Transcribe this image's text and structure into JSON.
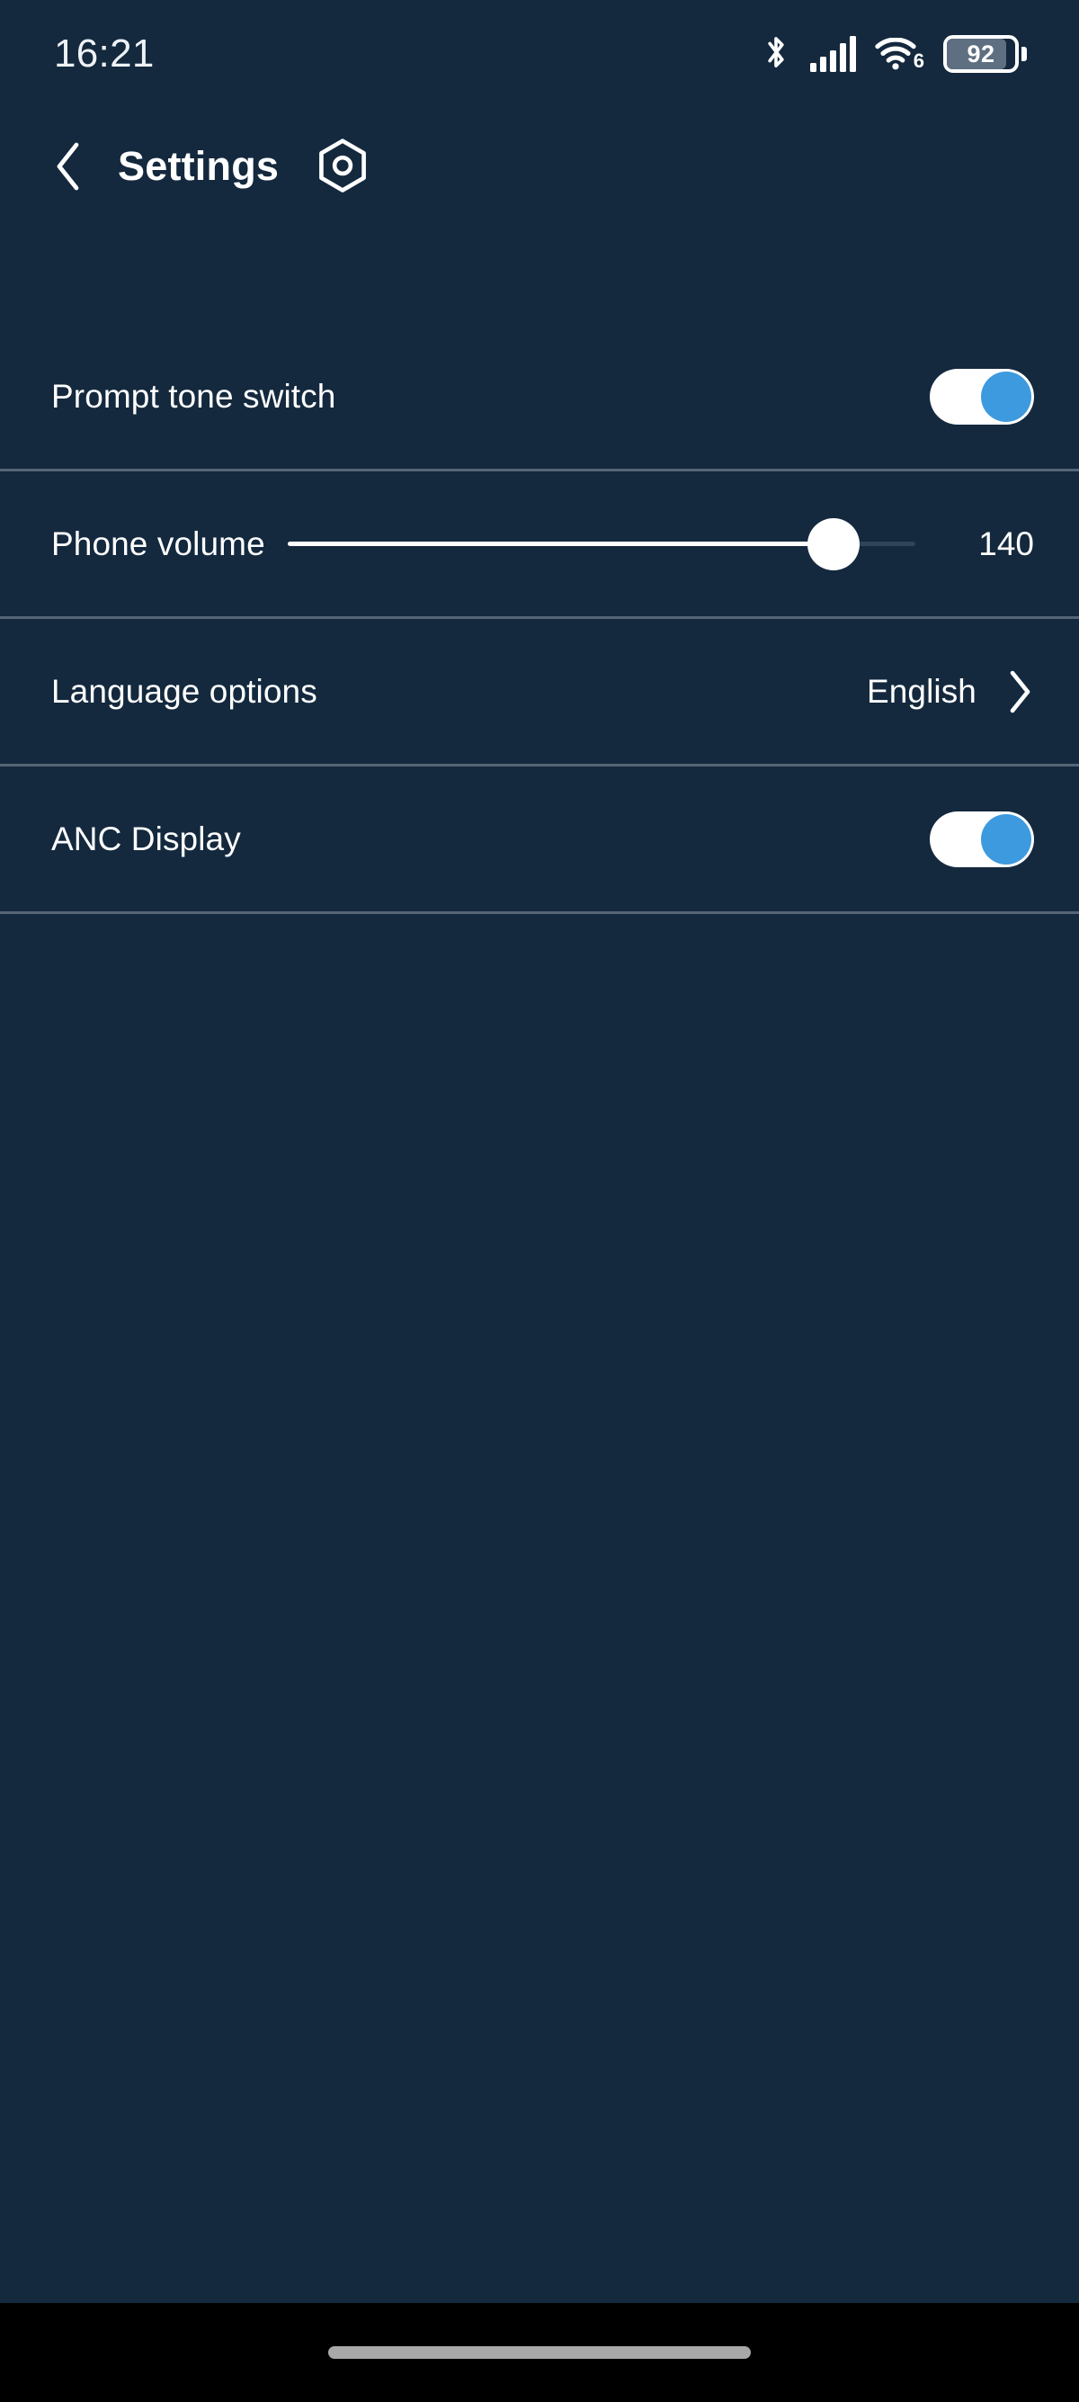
{
  "theme": {
    "background": "#14293e",
    "divider": "#566575",
    "accent_blue": "#3d9ade",
    "text_primary": "#ffffff",
    "navbar_background": "#000000",
    "slider_track_inactive": "#2f4457"
  },
  "status_bar": {
    "time": "16:21",
    "bluetooth_icon": "bluetooth-icon",
    "signal_icon": "cellular-signal-icon",
    "signal_bars_filled": 5,
    "signal_bars_total": 5,
    "wifi_icon": "wifi-icon",
    "wifi_generation": "6",
    "battery_icon": "battery-icon",
    "battery_level": "92"
  },
  "header": {
    "back_icon": "chevron-left-icon",
    "title": "Settings",
    "device_icon": "hex-nut-icon"
  },
  "settings": {
    "rows": [
      {
        "id": "prompt-tone-switch",
        "label": "Prompt tone switch",
        "control": "toggle",
        "value": "on"
      },
      {
        "id": "phone-volume",
        "label": "Phone volume",
        "control": "slider",
        "value": "140",
        "fill_percent": 87
      },
      {
        "id": "language-options",
        "label": "Language options",
        "control": "navigation",
        "value": "English",
        "chevron_icon": "chevron-right-icon"
      },
      {
        "id": "anc-display",
        "label": "ANC Display",
        "control": "toggle",
        "value": "on"
      }
    ]
  },
  "nav_bar": {
    "gesture_pill": "home-gesture-pill"
  }
}
